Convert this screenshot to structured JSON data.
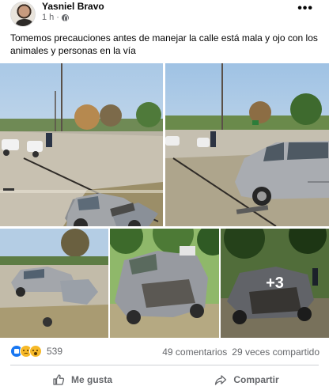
{
  "post": {
    "author": "Yasniel Bravo",
    "time": "1 h",
    "more_icon": "more-horizontal-icon",
    "text": "Tomemos precauciones antes de manejar la calle está mala y ojo con los animales y personas en la vía"
  },
  "photos": {
    "count": 5,
    "more_overlay": "+3"
  },
  "engagement": {
    "reactions": [
      "like-icon",
      "sad-icon",
      "wow-icon"
    ],
    "reaction_count": "539",
    "comments": "49 comentarios",
    "shares": "29 veces compartido"
  },
  "actions": {
    "like_label": "Me gusta",
    "share_label": "Compartir"
  },
  "colors": {
    "accent": "#1877f2",
    "muted_text": "#65676b",
    "divider": "#ced0d4"
  }
}
